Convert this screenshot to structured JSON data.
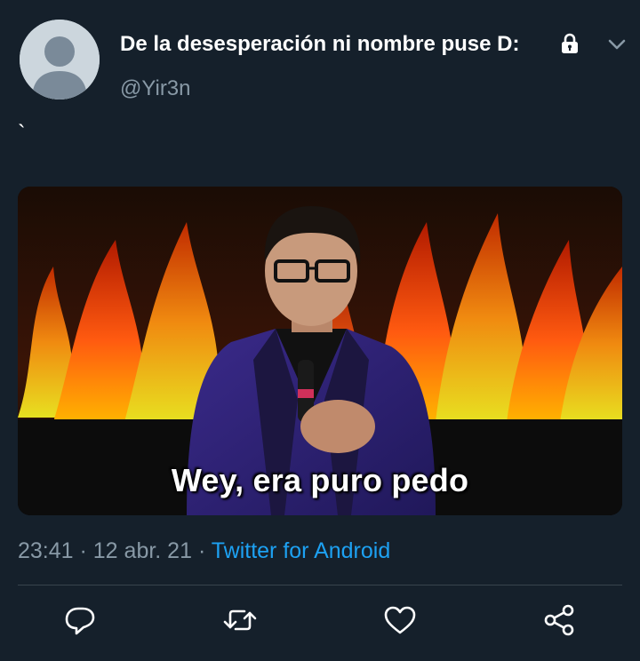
{
  "tweet": {
    "display_name": "De la desesperación ni nombre puse D:",
    "handle": "@Yir3n",
    "text": "`",
    "media_caption": "Wey, era puro pedo",
    "time": "23:41",
    "date": "12 abr. 21",
    "source": "Twitter for Android",
    "separator": " · "
  },
  "icons": {
    "lock": "lock-icon",
    "menu": "chevron-down-icon",
    "reply": "reply-icon",
    "retweet": "retweet-icon",
    "like": "heart-icon",
    "share": "share-icon"
  },
  "colors": {
    "background": "#15202b",
    "secondary_text": "#8899a6",
    "link": "#1da1f2",
    "divider": "#38444d"
  }
}
